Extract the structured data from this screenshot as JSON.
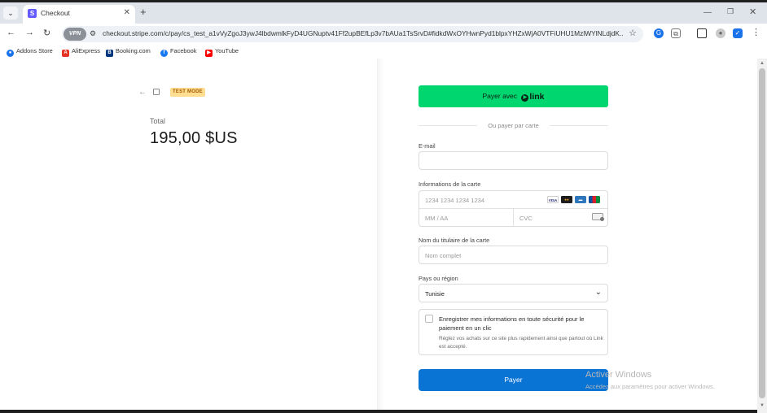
{
  "browser": {
    "tab_title": "Checkout",
    "tab_favicon_letter": "S",
    "url": "checkout.stripe.com/c/pay/cs_test_a1vVyZgoJ3ywJ4lbdwmlkFyD4UGNuptv41Ff2upBEfLp3v7bAUa1TsSrvD#fidkdWxOYHwnPyd1blpxYHZxWjA0VTFiUHU1MzlWYlNLdjdK...",
    "vpn_label": "VPN",
    "bookmarks": [
      {
        "label": "Addons Store",
        "icon": "addons-store-icon",
        "color": "#1a73e8"
      },
      {
        "label": "AliExpress",
        "icon": "aliexpress-icon",
        "color": "#e43225"
      },
      {
        "label": "Booking.com",
        "icon": "booking-icon",
        "color": "#003580"
      },
      {
        "label": "Facebook",
        "icon": "facebook-icon",
        "color": "#1877f2"
      },
      {
        "label": "YouTube",
        "icon": "youtube-icon",
        "color": "#ff0000"
      }
    ]
  },
  "summary": {
    "test_mode_badge": "TEST MODE",
    "total_label": "Total",
    "total_amount": "195,00 $US"
  },
  "form": {
    "link_button_prefix": "Payer avec",
    "link_logo_text": "link",
    "divider_text": "Ou payer par carte",
    "email_label": "E-mail",
    "email_value": "",
    "card_label": "Informations de la carte",
    "card_number_placeholder": "1234 1234 1234 1234",
    "expiry_placeholder": "MM / AA",
    "cvc_placeholder": "CVC",
    "card_brands": [
      "VISA",
      "MC",
      "AMEX",
      "JCB"
    ],
    "cardholder_label": "Nom du titulaire de la carte",
    "cardholder_placeholder": "Nom complet",
    "country_label": "Pays ou région",
    "country_value": "Tunisie",
    "save_title": "Enregistrer mes informations en toute sécurité pour le paiement en un clic",
    "save_description": "Réglez vos achats sur ce site plus rapidement ainsi que partout où Link est accepté.",
    "save_checked": false,
    "pay_button_label": "Payer"
  },
  "watermark": {
    "line1": "Activer Windows",
    "line2": "Accédez aux paramètres pour activer Windows."
  },
  "colors": {
    "link_green": "#00d66f",
    "pay_blue": "#0a74d5",
    "test_badge_bg": "#ffde92",
    "stripe_purple": "#635bff"
  }
}
